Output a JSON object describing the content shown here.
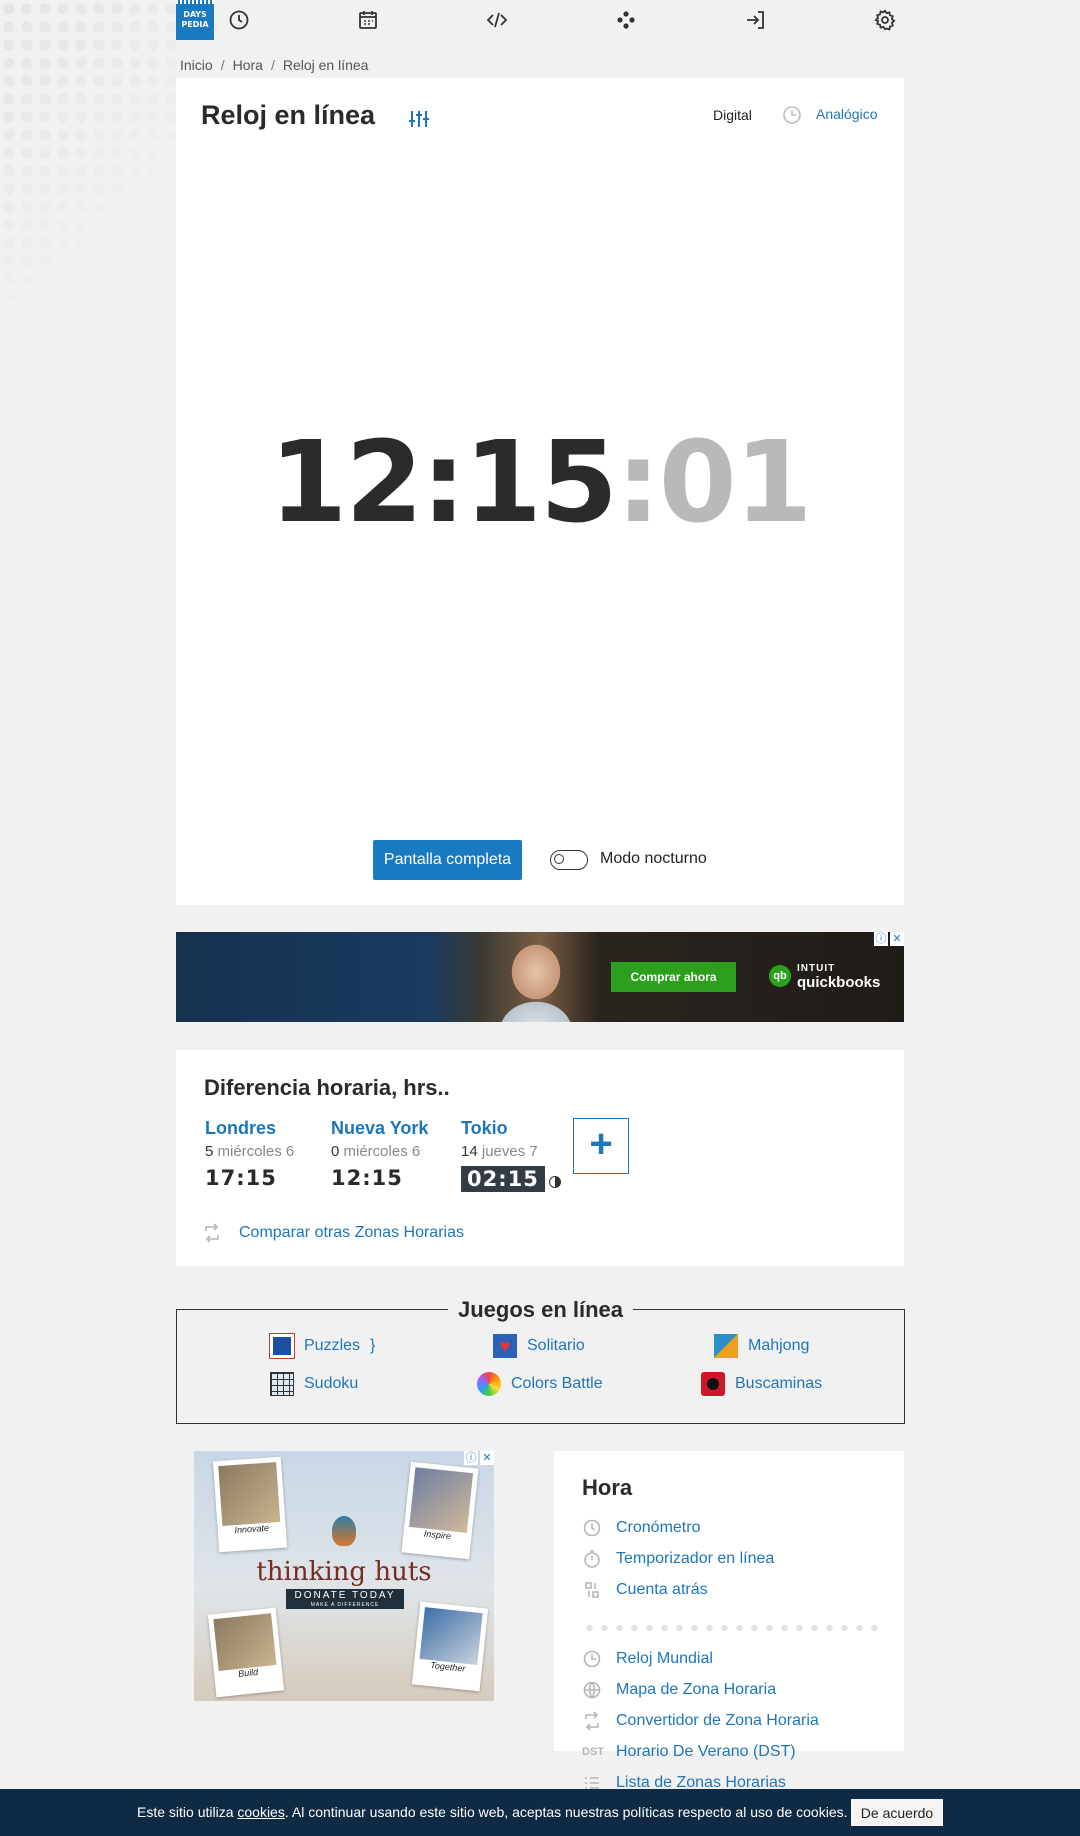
{
  "nav": {
    "logo_line1": "DAYS",
    "logo_line2": "PEDIA",
    "icons": [
      "clock-icon",
      "calendar-icon",
      "code-icon",
      "games-icon",
      "login-icon",
      "gear-icon"
    ]
  },
  "breadcrumb": [
    "Inicio",
    "Hora",
    "Reloj en línea"
  ],
  "clock": {
    "title": "Reloj en línea",
    "mode_digital": "Digital",
    "mode_analog": "Analógico",
    "time_hm": "12:15",
    "time_sec": ":01",
    "fullscreen_label": "Pantalla completa",
    "night_mode_label": "Modo nocturno",
    "night_mode_on": false
  },
  "ad1": {
    "button": "Comprar ahora",
    "brand_small": "INTUIT",
    "brand": "quickbooks",
    "qb_mark": "qb"
  },
  "time_diff": {
    "title": "Diferencia horaria, hrs..",
    "cities": [
      {
        "name": "Londres",
        "offset": "5",
        "day": "miércoles 6",
        "time": "17:15"
      },
      {
        "name": "Nueva York",
        "offset": "0",
        "day": "miércoles 6",
        "time": "12:15"
      },
      {
        "name": "Tokio",
        "offset": "14",
        "day": "jueves 7",
        "time": "02:15"
      }
    ],
    "add_label": "+",
    "compare_label": "Comparar otras Zonas Horarias"
  },
  "games": {
    "title": "Juegos en línea",
    "items": [
      "Puzzles",
      "Solitario",
      "Mahjong",
      "Sudoku",
      "Colors Battle",
      "Buscaminas"
    ]
  },
  "ad2": {
    "title": "thinking huts",
    "donate": "DONATE TODAY",
    "donate_sub": "MAKE A DIFFERENCE",
    "captions": [
      "Innovate",
      "Inspire",
      "Build",
      "Together"
    ]
  },
  "hora": {
    "title": "Hora",
    "items": [
      "Cronómetro",
      "Temporizador en línea",
      "Cuenta atrás",
      "Reloj Mundial",
      "Mapa de Zona Horaria",
      "Convertidor de Zona Horaria",
      "Horario De Verano (DST)",
      "Lista de Zonas Horarias"
    ],
    "dst_icon_text": "DST"
  },
  "cookie": {
    "text_before": "Este sitio utiliza ",
    "link": "cookies",
    "text_after": ". Al continuar usando este sitio web, aceptas nuestras políticas respecto al uso de cookies.",
    "button": "De acuerdo"
  },
  "colors": {
    "accent": "#1a7ac1",
    "link": "#1d76bc",
    "cookie_bar": "#0f2a44",
    "buy_button": "#2ca01c"
  }
}
